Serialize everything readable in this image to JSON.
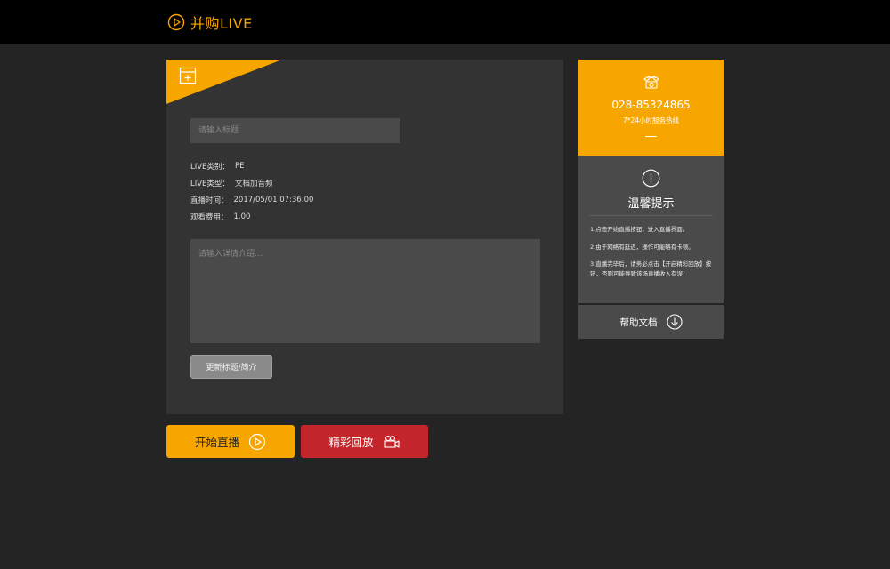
{
  "header": {
    "brand": "并购LIVE",
    "brand_icon": "play-circle-icon"
  },
  "form": {
    "title_placeholder": "请输入标题",
    "info": [
      {
        "label": "LIVE类别：",
        "value": "PE"
      },
      {
        "label": "LIVE类型：",
        "value": "文档加音频"
      },
      {
        "label": "直播时间：",
        "value": "2017/05/01 07:36:00"
      },
      {
        "label": "观看费用：",
        "value": "1.00"
      }
    ],
    "description_placeholder": "请输入详情介绍...",
    "update_label": "更新标题/简介"
  },
  "actions": {
    "start_label": "开始直播",
    "replay_label": "精彩回放"
  },
  "hotline": {
    "number": "028-85324865",
    "subtitle": "7*24小时服务热线"
  },
  "tips": {
    "title": "温馨提示",
    "items": [
      "1.点击开始直播按钮，进入直播界面。",
      "2.由于网络有延迟，操作可能略有卡顿。",
      "3.直播完毕后，请务必点击【开启精彩回放】按钮，否则可能导致该场直播收入有误！"
    ]
  },
  "help": {
    "label": "帮助文档"
  },
  "colors": {
    "accent": "#f7a600",
    "danger": "#c4262b",
    "panel": "#333333"
  }
}
